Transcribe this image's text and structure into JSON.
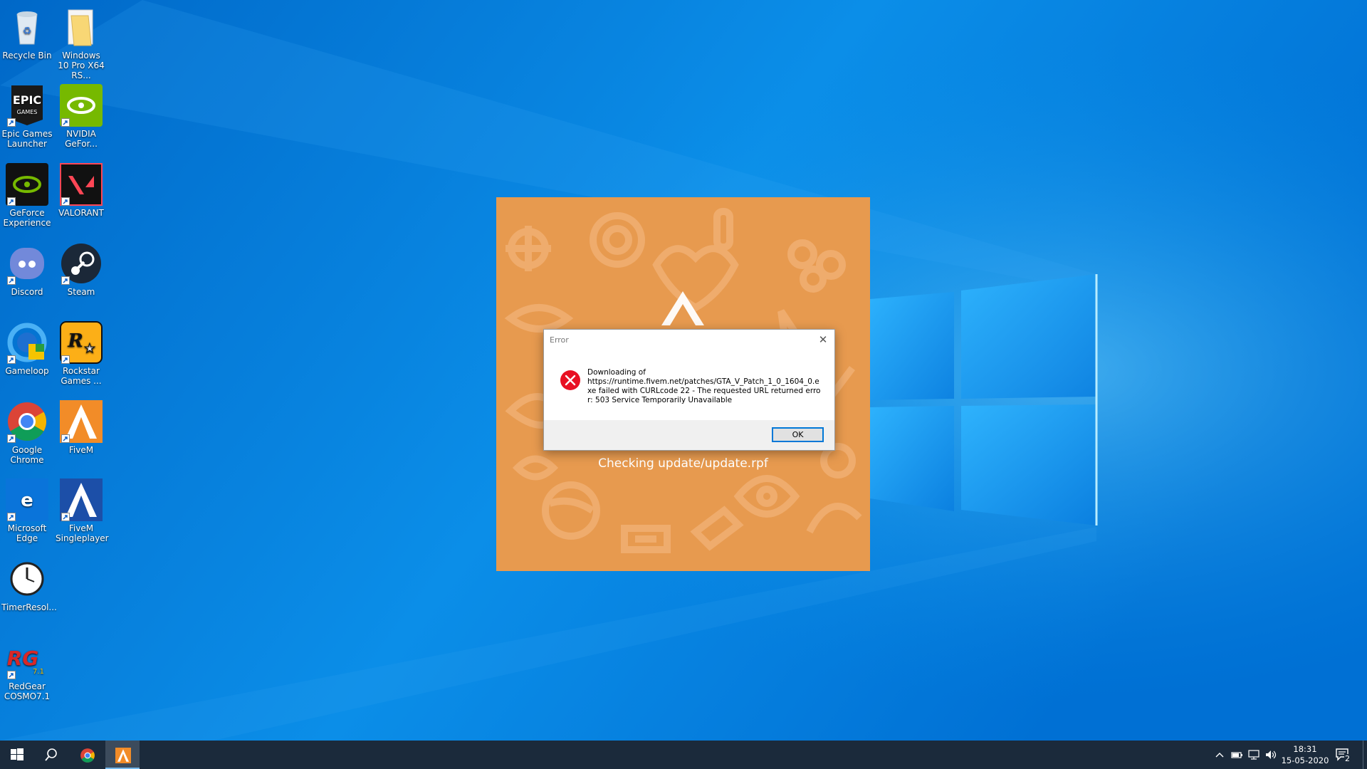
{
  "colors": {
    "desktop_bg": "#0079d6",
    "splash_bg": "#e79a4f",
    "taskbar_bg": "#1b2a3b",
    "dialog_button_border": "#0078d7"
  },
  "desktop": {
    "icons": [
      {
        "label": "Recycle Bin",
        "icon": "recycle-bin-icon"
      },
      {
        "label": "Windows 10 Pro X64 RS...",
        "icon": "folder-icon"
      },
      {
        "label": "Epic Games Launcher",
        "icon": "epic-games-icon"
      },
      {
        "label": "NVIDIA GeFor...",
        "icon": "nvidia-icon"
      },
      {
        "label": "GeForce Experience",
        "icon": "geforce-experience-icon"
      },
      {
        "label": "VALORANT",
        "icon": "valorant-icon"
      },
      {
        "label": "Discord",
        "icon": "discord-icon"
      },
      {
        "label": "Steam",
        "icon": "steam-icon"
      },
      {
        "label": "Gameloop",
        "icon": "gameloop-icon"
      },
      {
        "label": "Rockstar Games ...",
        "icon": "rockstar-icon"
      },
      {
        "label": "Google Chrome",
        "icon": "chrome-icon"
      },
      {
        "label": "FiveM",
        "icon": "fivem-icon"
      },
      {
        "label": "Microsoft Edge",
        "icon": "edge-icon"
      },
      {
        "label": "FiveM Singleplayer",
        "icon": "fivem-singleplayer-icon"
      },
      {
        "label": "TimerResol...",
        "icon": "clock-icon"
      },
      {
        "label": "RedGear COSMO7.1",
        "icon": "redgear-icon"
      }
    ]
  },
  "splash": {
    "status_text": "Checking update/update.rpf"
  },
  "dialog": {
    "title": "Error",
    "close_glyph": "✕",
    "message": "Downloading of\nhttps://runtime.fivem.net/patches/GTA_V_Patch_1_0_1604_0.exe failed with CURLcode 22 - The requested URL returned error: 503 Service Temporarily Unavailable",
    "ok_label": "OK",
    "icon": "error-icon"
  },
  "taskbar": {
    "start": "windows-start-icon",
    "search": "search-icon",
    "apps": [
      {
        "name": "Google Chrome",
        "icon": "chrome-icon"
      },
      {
        "name": "FiveM",
        "icon": "fivem-icon",
        "active": true
      }
    ],
    "tray_icons": [
      "chevron-up-icon",
      "battery-icon",
      "network-icon",
      "volume-icon"
    ],
    "time": "18:31",
    "date": "15-05-2020",
    "notifications_count": "2"
  }
}
